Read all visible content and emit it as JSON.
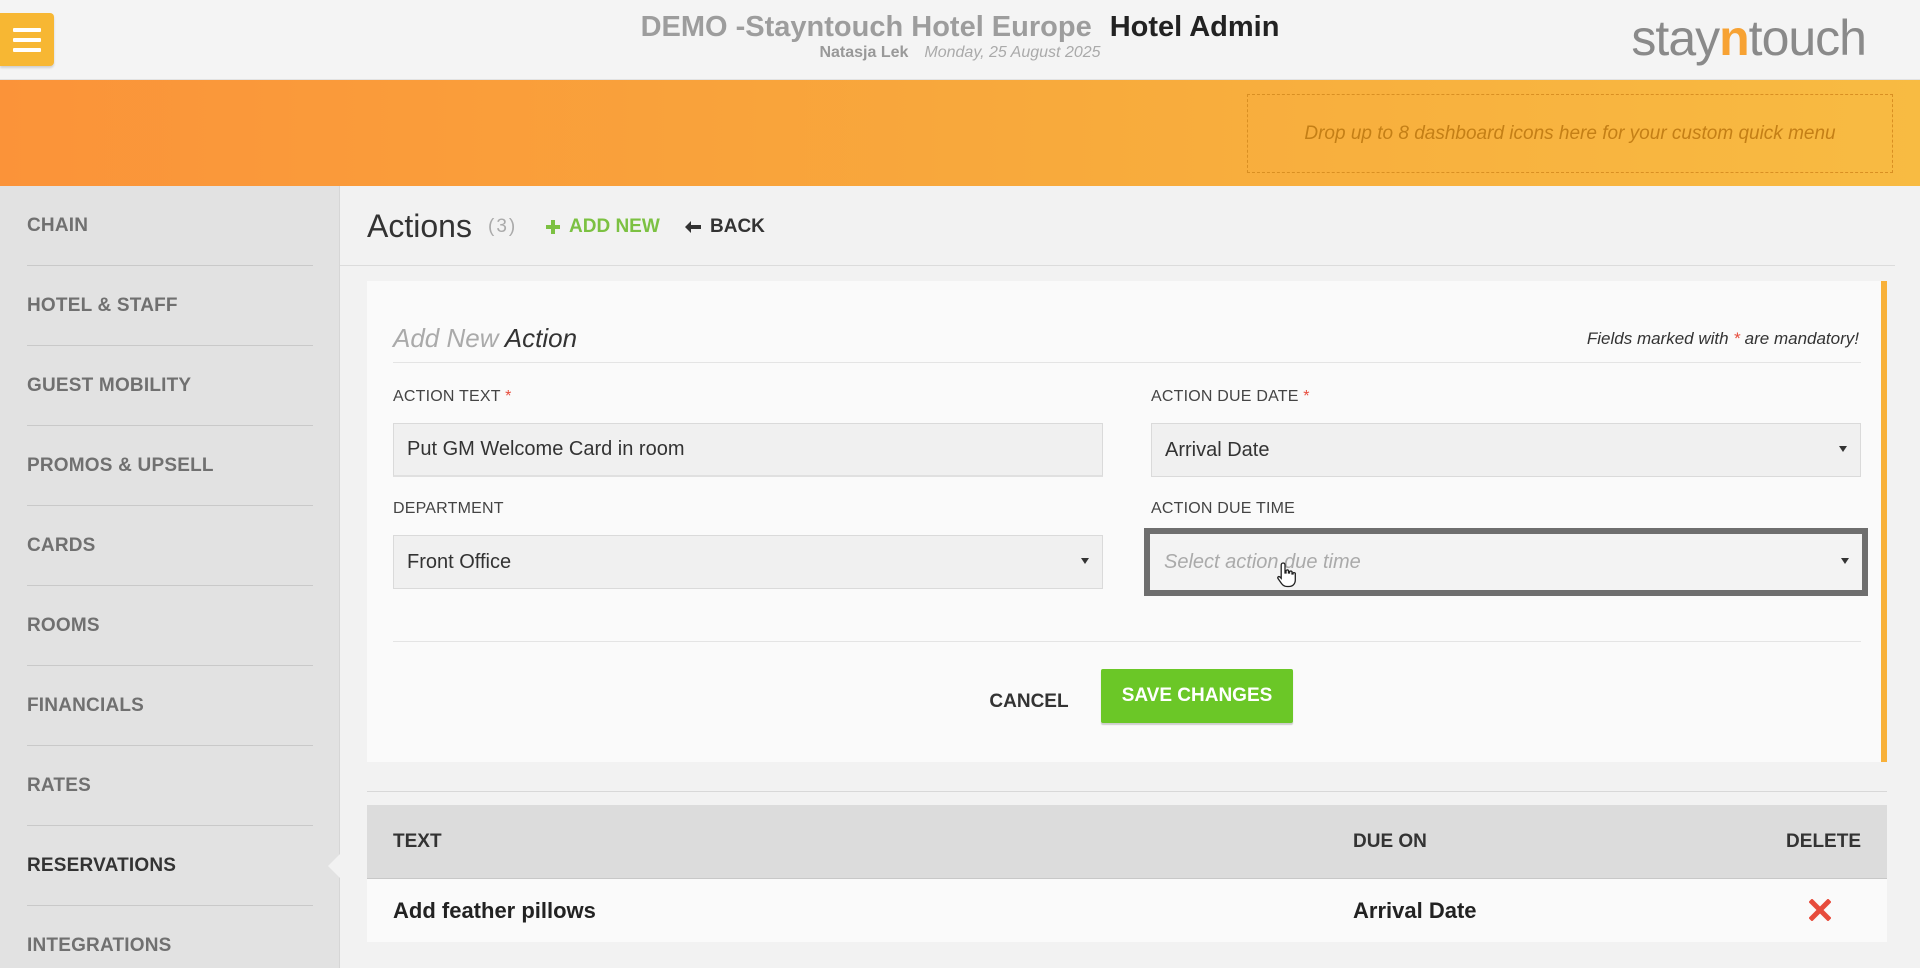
{
  "header": {
    "hotel_name": "DEMO -Stayntouch Hotel Europe",
    "app_name": "Hotel Admin",
    "user_name": "Natasja Lek",
    "date": "Monday, 25 August 2025",
    "logo_left": "stay",
    "logo_n": "n",
    "logo_right": "touch"
  },
  "quick_menu": {
    "dropzone_text": "Drop up to 8 dashboard icons here for your custom quick menu"
  },
  "sidebar": {
    "items": [
      {
        "label": "CHAIN"
      },
      {
        "label": "HOTEL & STAFF"
      },
      {
        "label": "GUEST MOBILITY"
      },
      {
        "label": "PROMOS & UPSELL"
      },
      {
        "label": "CARDS"
      },
      {
        "label": "ROOMS"
      },
      {
        "label": "FINANCIALS"
      },
      {
        "label": "RATES"
      },
      {
        "label": "RESERVATIONS"
      },
      {
        "label": "INTEGRATIONS"
      }
    ],
    "active_index": 8
  },
  "page": {
    "title": "Actions",
    "count": "(3)",
    "add_new_label": "ADD NEW",
    "back_label": "BACK"
  },
  "form": {
    "heading_prefix": "Add New",
    "heading_main": "Action",
    "mandatory_prefix": "Fields marked with ",
    "mandatory_star": "*",
    "mandatory_suffix": " are mandatory!",
    "action_text_label": "ACTION TEXT",
    "action_text_value": "Put GM Welcome Card in room",
    "due_date_label": "ACTION DUE DATE",
    "due_date_value": "Arrival Date",
    "department_label": "DEPARTMENT",
    "department_value": "Front Office",
    "due_time_label": "ACTION DUE TIME",
    "due_time_placeholder": "Select action due time",
    "required_star": "*",
    "cancel_label": "CANCEL",
    "save_label": "SAVE CHANGES"
  },
  "table": {
    "columns": [
      "TEXT",
      "DUE ON",
      "DELETE"
    ],
    "rows": [
      {
        "text": "Add feather pillows",
        "due_on": "Arrival Date"
      }
    ]
  },
  "colors": {
    "accent_orange": "#f8aa3c",
    "add_green": "#7cc142",
    "save_green": "#6bc727",
    "delete_red": "#e74c3c"
  }
}
